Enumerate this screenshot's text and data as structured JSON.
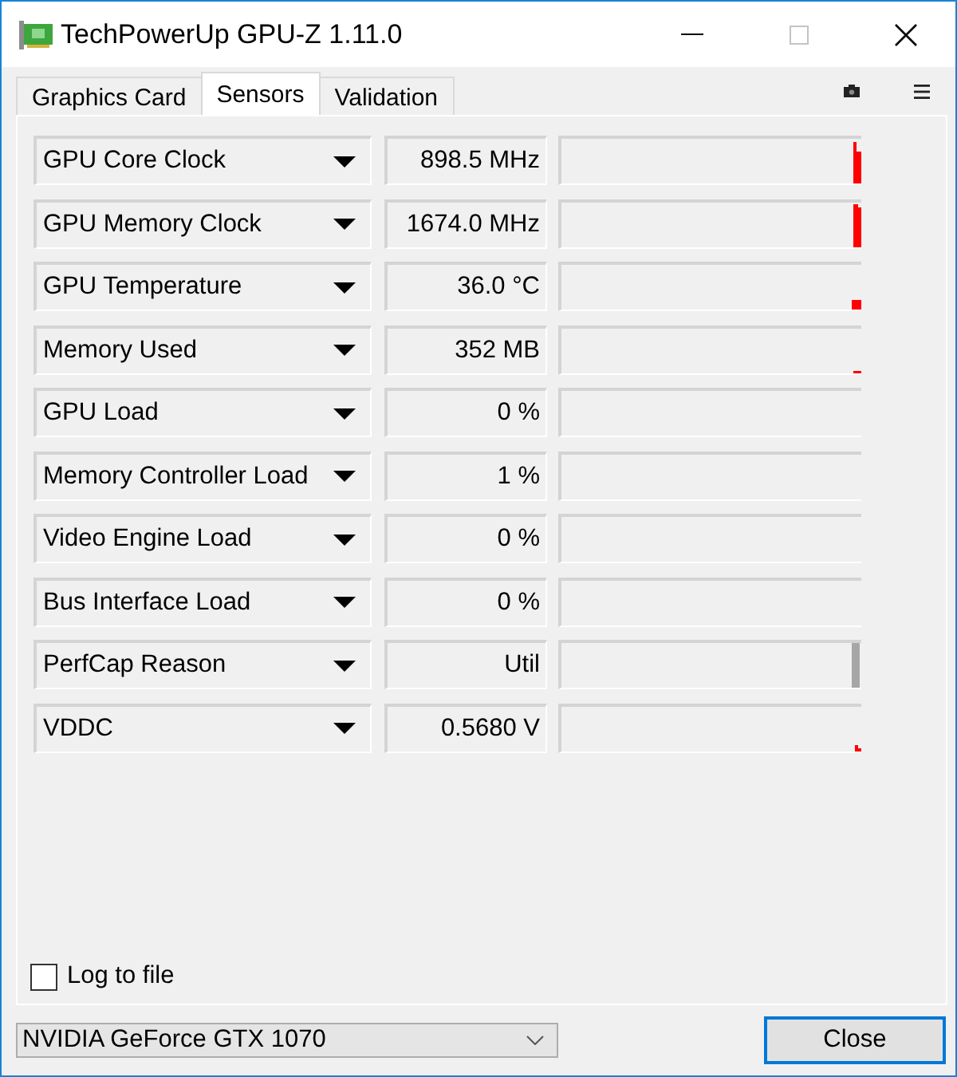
{
  "window": {
    "title": "TechPowerUp GPU-Z 1.11.0",
    "caption_buttons": [
      {
        "kind": "minimize",
        "disabled": false
      },
      {
        "kind": "maximize",
        "disabled": true
      },
      {
        "kind": "close",
        "disabled": false
      }
    ]
  },
  "tabs": [
    {
      "label": "Graphics Card",
      "selected": false
    },
    {
      "label": "Sensors",
      "selected": true
    },
    {
      "label": "Validation",
      "selected": false
    }
  ],
  "sensors": [
    {
      "name": "GPU Core Clock",
      "value": "898.5 MHz",
      "color": "#ff0000"
    },
    {
      "name": "GPU Memory Clock",
      "value": "1674.0 MHz",
      "color": "#ff0000"
    },
    {
      "name": "GPU Temperature",
      "value": "36.0 °C",
      "color": "#ff0000"
    },
    {
      "name": "Memory Used",
      "value": "352 MB",
      "color": "#ff0000"
    },
    {
      "name": "GPU Load",
      "value": "0 %"
    },
    {
      "name": "Memory Controller Load",
      "value": "1 %"
    },
    {
      "name": "Video Engine Load",
      "value": "0 %"
    },
    {
      "name": "Bus Interface Load",
      "value": "0 %"
    },
    {
      "name": "PerfCap Reason",
      "value": "Util",
      "color": "#a6a6a6"
    },
    {
      "name": "VDDC",
      "value": "0.5680 V",
      "color": "#ff0000"
    }
  ],
  "log_to_file": {
    "label": "Log to file",
    "checked": false
  },
  "device_select": {
    "value": "NVIDIA GeForce GTX 1070"
  },
  "buttons": [
    {
      "label": "Close",
      "default": true
    }
  ]
}
